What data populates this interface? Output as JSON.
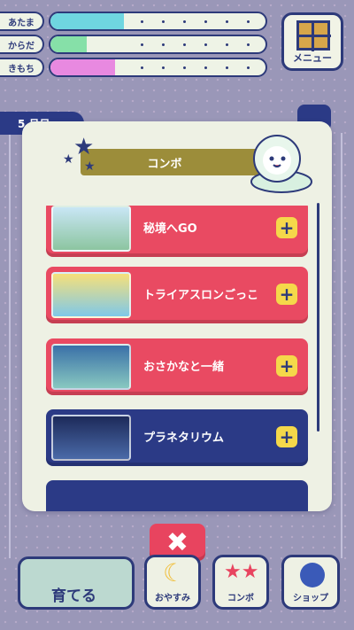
{
  "stats": [
    {
      "label": "あたま",
      "level": 0.34,
      "color": "#6fd6e0"
    },
    {
      "label": "からだ",
      "level": 0.17,
      "color": "#86e0a8"
    },
    {
      "label": "きもち",
      "level": 0.3,
      "color": "#e889e0"
    }
  ],
  "menu": {
    "label": "メニュー",
    "icon": "window-grid-icon"
  },
  "date": {
    "label": "5 月日"
  },
  "panel": {
    "title": "コンボ",
    "items": [
      {
        "name": "秘境へGO",
        "color": "#e94a62",
        "add": "+"
      },
      {
        "name": "トライアスロンごっこ",
        "color": "#e94a62",
        "add": "+"
      },
      {
        "name": "おさかなと一緒",
        "color": "#e94a62",
        "add": "+"
      },
      {
        "name": "プラネタリウム",
        "color": "#2b3a86",
        "add": "+"
      }
    ]
  },
  "close": {
    "label": "✖"
  },
  "nav": {
    "raise": "育てる",
    "rest": "おやすみ",
    "combo": "コンボ",
    "shop": "ショップ"
  }
}
